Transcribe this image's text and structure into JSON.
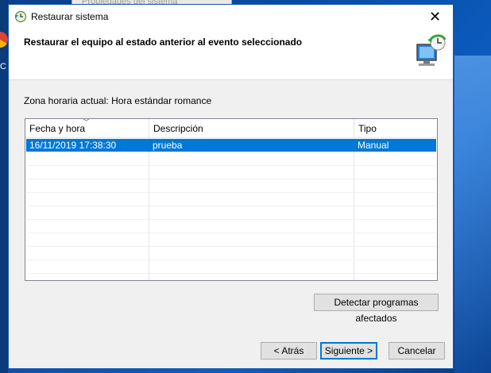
{
  "background_window": {
    "title": "Propiedades del sistema"
  },
  "desktop": {
    "icon_label": "C"
  },
  "dialog": {
    "title": "Restaurar sistema",
    "close_label": "✕",
    "header_title": "Restaurar el equipo al estado anterior al evento seleccionado",
    "timezone": "Zona horaria actual: Hora estándar romance",
    "table": {
      "columns": [
        "Fecha y hora",
        "Descripción",
        "Tipo"
      ],
      "sort_indicator": "﹀",
      "rows": [
        {
          "date": "16/11/2019 17:38:30",
          "description": "prueba",
          "type": "Manual",
          "selected": true
        }
      ],
      "empty_rows": 10
    },
    "buttons": {
      "detect": "Detectar programas afectados",
      "back": "< Atrás",
      "next": "Siguiente >",
      "cancel": "Cancelar"
    }
  },
  "colors": {
    "selection": "#0078d7",
    "dialog_bg": "#f0f0f0",
    "desktop": "#0b4fa6"
  }
}
